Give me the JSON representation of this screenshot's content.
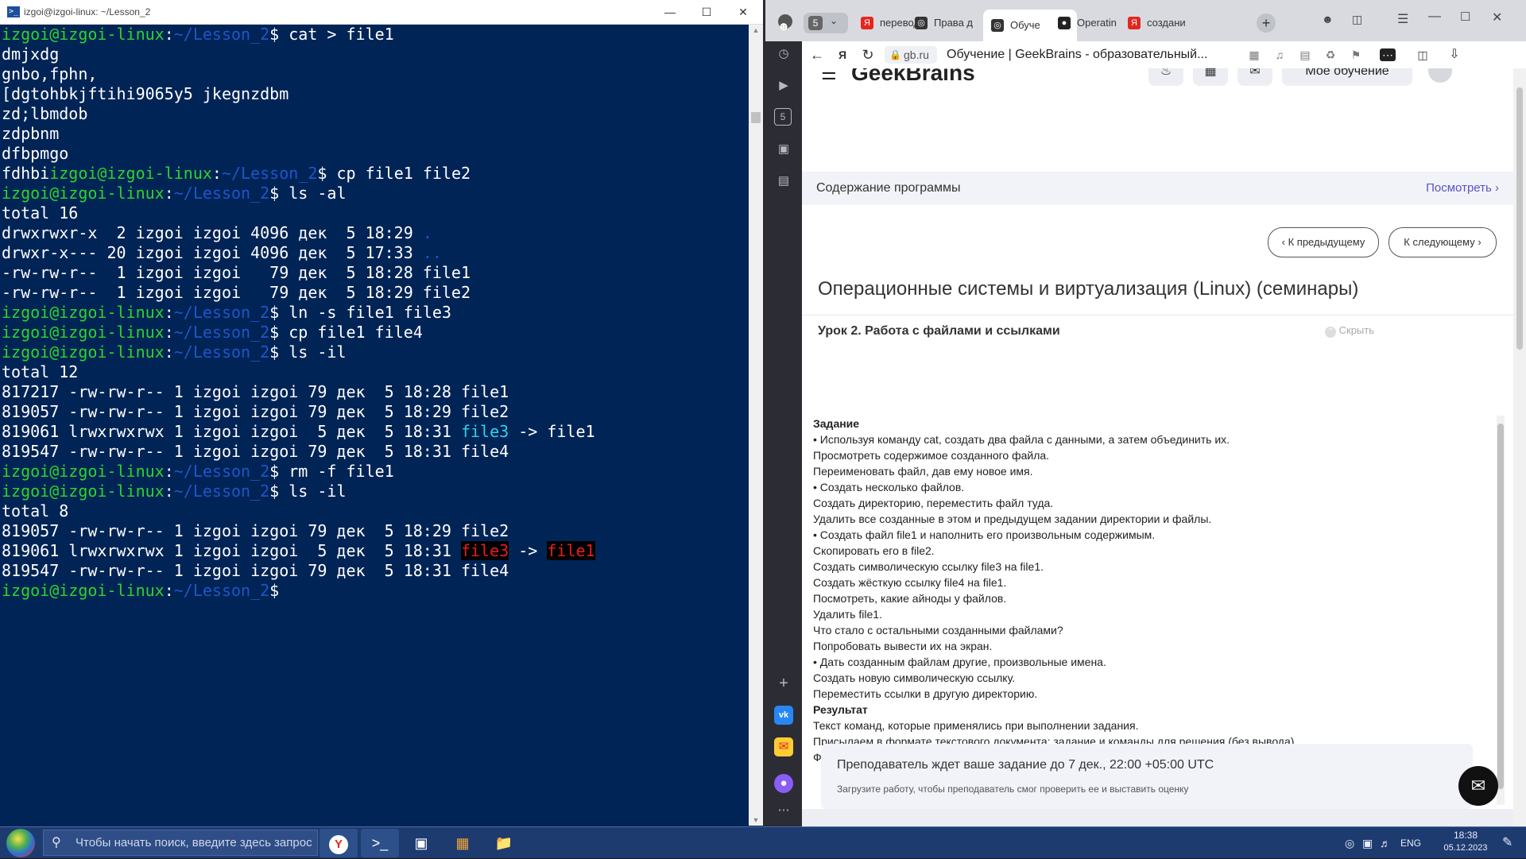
{
  "terminal": {
    "title": "izgoi@izgoi-linux: ~/Lesson_2",
    "prompt_user": "izgoi@izgoi-linux",
    "prompt_path": "~/Lesson_2",
    "lines": [
      [
        {
          "t": "izgoi@izgoi-linux",
          "c": "u"
        },
        {
          "t": ":"
        },
        {
          "t": "~/Lesson_2",
          "c": "p"
        },
        {
          "t": "$ cat > file1"
        }
      ],
      [
        {
          "t": "dmjxdg"
        }
      ],
      [
        {
          "t": "gnbo,fphn,"
        }
      ],
      [
        {
          "t": "[dgtohbkjftihi9065y5 jkegnzdbm"
        }
      ],
      [
        {
          "t": "zd;lbmdob"
        }
      ],
      [
        {
          "t": "zdpbnm"
        }
      ],
      [
        {
          "t": "dfbpmgo"
        }
      ],
      [
        {
          "t": "fdhbi"
        },
        {
          "t": "izgoi@izgoi-linux",
          "c": "u"
        },
        {
          "t": ":"
        },
        {
          "t": "~/Lesson_2",
          "c": "p"
        },
        {
          "t": "$ cp file1 file2"
        }
      ],
      [
        {
          "t": "izgoi@izgoi-linux",
          "c": "u"
        },
        {
          "t": ":"
        },
        {
          "t": "~/Lesson_2",
          "c": "p"
        },
        {
          "t": "$ ls -al"
        }
      ],
      [
        {
          "t": "total 16"
        }
      ],
      [
        {
          "t": "drwxrwxr-x  2 izgoi izgoi 4096 дек  5 18:29 "
        },
        {
          "t": ".",
          "c": "p"
        }
      ],
      [
        {
          "t": "drwxr-x--- 20 izgoi izgoi 4096 дек  5 17:33 "
        },
        {
          "t": "..",
          "c": "p"
        }
      ],
      [
        {
          "t": "-rw-rw-r--  1 izgoi izgoi   79 дек  5 18:28 file1"
        }
      ],
      [
        {
          "t": "-rw-rw-r--  1 izgoi izgoi   79 дек  5 18:29 file2"
        }
      ],
      [
        {
          "t": "izgoi@izgoi-linux",
          "c": "u"
        },
        {
          "t": ":"
        },
        {
          "t": "~/Lesson_2",
          "c": "p"
        },
        {
          "t": "$ ln -s file1 file3"
        }
      ],
      [
        {
          "t": "izgoi@izgoi-linux",
          "c": "u"
        },
        {
          "t": ":"
        },
        {
          "t": "~/Lesson_2",
          "c": "p"
        },
        {
          "t": "$ cp file1 file4"
        }
      ],
      [
        {
          "t": "izgoi@izgoi-linux",
          "c": "u"
        },
        {
          "t": ":"
        },
        {
          "t": "~/Lesson_2",
          "c": "p"
        },
        {
          "t": "$ ls -il"
        }
      ],
      [
        {
          "t": "total 12"
        }
      ],
      [
        {
          "t": "817217 -rw-rw-r-- 1 izgoi izgoi 79 дек  5 18:28 file1"
        }
      ],
      [
        {
          "t": "819057 -rw-rw-r-- 1 izgoi izgoi 79 дек  5 18:29 file2"
        }
      ],
      [
        {
          "t": "819061 lrwxrwxrwx 1 izgoi izgoi  5 дек  5 18:31 "
        },
        {
          "t": "file3",
          "c": "c"
        },
        {
          "t": " -> file1"
        }
      ],
      [
        {
          "t": "819547 -rw-rw-r-- 1 izgoi izgoi 79 дек  5 18:31 file4"
        }
      ],
      [
        {
          "t": "izgoi@izgoi-linux",
          "c": "u"
        },
        {
          "t": ":"
        },
        {
          "t": "~/Lesson_2",
          "c": "p"
        },
        {
          "t": "$ rm -f file1"
        }
      ],
      [
        {
          "t": "izgoi@izgoi-linux",
          "c": "u"
        },
        {
          "t": ":"
        },
        {
          "t": "~/Lesson_2",
          "c": "p"
        },
        {
          "t": "$ ls -il"
        }
      ],
      [
        {
          "t": "total 8"
        }
      ],
      [
        {
          "t": "819057 -rw-rw-r-- 1 izgoi izgoi 79 дек  5 18:29 file2"
        }
      ],
      [
        {
          "t": "819061 lrwxrwxrwx 1 izgoi izgoi  5 дек  5 18:31 "
        },
        {
          "t": "file3",
          "c": "hl"
        },
        {
          "t": " -> "
        },
        {
          "t": "file1",
          "c": "hl"
        }
      ],
      [
        {
          "t": "819547 -rw-rw-r-- 1 izgoi izgoi 79 дек  5 18:31 file4"
        }
      ],
      [
        {
          "t": "izgoi@izgoi-linux",
          "c": "u"
        },
        {
          "t": ":"
        },
        {
          "t": "~/Lesson_2",
          "c": "p"
        },
        {
          "t": "$"
        }
      ]
    ]
  },
  "browser": {
    "tab_count": "5",
    "tabs": [
      {
        "label": "перевод",
        "icon": "yandex-icon",
        "color": "#e52620"
      },
      {
        "label": "Права д",
        "icon": "chatgpt-icon",
        "color": "#333333"
      },
      {
        "label": "Обуче",
        "icon": "chatgpt-icon",
        "color": "#333333",
        "active": true
      },
      {
        "label": "Operatin",
        "icon": "github-icon",
        "color": "#222222"
      },
      {
        "label": "создани",
        "icon": "yandex-icon",
        "color": "#e52620"
      }
    ],
    "domain": "gb.ru",
    "page_title": "Обучение | GeekBrains - образовательный...",
    "logo": "GeekBrains",
    "my_learning": "Мое обучение",
    "program_label": "Содержание программы",
    "program_link": "Посмотреть",
    "prev_button": "К предыдущему",
    "next_button": "К следующему",
    "course_title": "Операционные системы и виртуализация (Linux) (семинары)",
    "lesson_title": "Урок 2. Работа с файлами и ссылками",
    "hide_label": "Скрыть",
    "task_lines": [
      {
        "t": "Задание",
        "b": true
      },
      {
        "t": "• Используя команду cat, создать два файла с данными, а затем объединить их."
      },
      {
        "t": "Просмотреть содержимое созданного файла."
      },
      {
        "t": "Переименовать файл, дав ему новое имя."
      },
      {
        "t": "• Создать несколько файлов."
      },
      {
        "t": "Создать директорию, переместить файл туда."
      },
      {
        "t": "Удалить все созданные в этом и предыдущем задании директории и файлы."
      },
      {
        "t": "• Создать файл file1 и наполнить его произвольным содержимым."
      },
      {
        "t": "Скопировать его в file2."
      },
      {
        "t": "Создать символическую ссылку file3 на file1."
      },
      {
        "t": "Создать жёсткую ссылку file4 на file1."
      },
      {
        "t": "Посмотреть, какие айноды у файлов."
      },
      {
        "t": "Удалить file1."
      },
      {
        "t": "Что стало с остальными созданными файлами?"
      },
      {
        "t": "Попробовать вывести их на экран."
      },
      {
        "t": "• Дать созданным файлам другие, произвольные имена."
      },
      {
        "t": "Создать новую символическую ссылку."
      },
      {
        "t": "Переместить ссылки в другую директорию."
      },
      {
        "t": "Результат",
        "b": true
      },
      {
        "t": "Текст команд, которые применялись при выполнении задания."
      },
      {
        "t": "Присылаем в формате текстового документа: задание и команды для решения (без вывода)."
      },
      {
        "t": "Формат — PDF (один файл на все задания)."
      }
    ],
    "deadline_title": "Преподаватель ждет ваше задание до 7 дек., 22:00 +05:00 UTC",
    "deadline_sub": "Загрузите работу, чтобы преподаватель смог проверить ее и выставить оценку"
  },
  "taskbar": {
    "search_placeholder": "Чтобы начать поиск, введите здесь запрос",
    "apps": [
      "yandex-browser-icon",
      "powershell-icon",
      "virtualbox-icon",
      "sublime-icon",
      "explorer-icon"
    ],
    "lang": "ENG",
    "time": "18:38",
    "date": "05.12.2023"
  }
}
